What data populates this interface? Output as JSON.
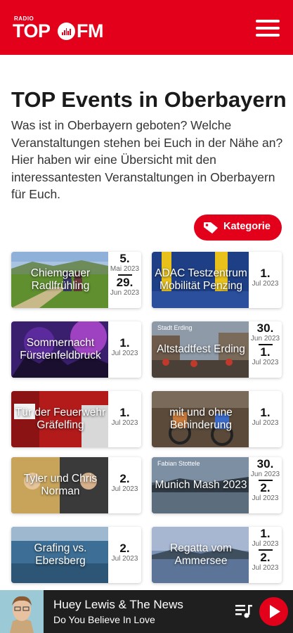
{
  "header": {
    "logo": {
      "radio": "RADIO",
      "top": "TOP",
      "fm": "FM"
    },
    "menu_icon": "hamburger-menu-icon"
  },
  "page": {
    "title": "TOP Events in Oberbayern",
    "intro": "Was ist in Oberbayern geboten? Welche Veranstaltungen stehen bei Euch in der Nähe an? Hier haben wir eine Übersicht mit den interessantesten Veranstaltungen in Oberbayern für Euch.",
    "category_button": {
      "label": "Kategorie",
      "icon": "tag-icon"
    }
  },
  "events": [
    {
      "title": "Chiemgauer Radlfrühling",
      "start": {
        "day": "5.",
        "month_year": "Mai 2023"
      },
      "end": {
        "day": "29.",
        "month_year": "Jun 2023"
      }
    },
    {
      "title": "ADAC Testzentrum Mobilität Penzing",
      "start": {
        "day": "1.",
        "month_year": "Jul 2023"
      }
    },
    {
      "title": "Sommernacht Fürstenfeldbruck",
      "start": {
        "day": "1.",
        "month_year": "Jul 2023"
      }
    },
    {
      "title": "Altstadtfest Erding",
      "image_text": "Stadt Erding",
      "start": {
        "day": "30.",
        "month_year": "Jun 2023"
      },
      "end": {
        "day": "1.",
        "month_year": "Jul 2023"
      }
    },
    {
      "title": "Tür der Feuerwehr Gräfelfing",
      "start": {
        "day": "1.",
        "month_year": "Jul 2023"
      }
    },
    {
      "title": "mit und ohne Behinderung",
      "start": {
        "day": "1.",
        "month_year": "Jul 2023"
      }
    },
    {
      "title": "Tyler und Chris Norman",
      "start": {
        "day": "2.",
        "month_year": "Jul 2023"
      }
    },
    {
      "title": "Munich Mash 2023",
      "image_text": "Fabian Stottele",
      "start": {
        "day": "30.",
        "month_year": "Jun 2023"
      },
      "end": {
        "day": "2.",
        "month_year": "Jul 2023"
      }
    },
    {
      "title": "Grafing vs. Ebersberg",
      "start": {
        "day": "2.",
        "month_year": "Jul 2023"
      }
    },
    {
      "title": "Regatta vom Ammersee",
      "start": {
        "day": "1.",
        "month_year": "Jul 2023"
      },
      "end": {
        "day": "2.",
        "month_year": "Jul 2023"
      }
    }
  ],
  "player": {
    "artist": "Huey Lewis & The News",
    "song": "Do You Believe In Love",
    "queue_icon": "playlist-icon",
    "play_icon": "play-icon"
  },
  "colors": {
    "brand": "#e3001b",
    "player_bg": "#1f1f1f"
  }
}
